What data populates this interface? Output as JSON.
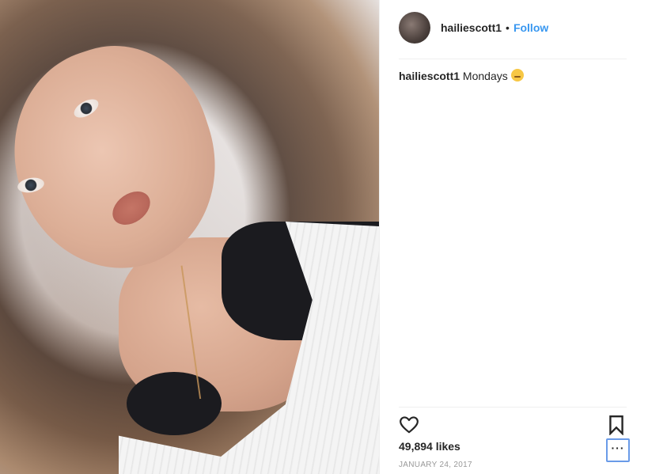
{
  "post": {
    "username": "hailiescott1",
    "follow_label": "Follow",
    "separator": "•",
    "caption_username": "hailiescott1",
    "caption_text": "Mondays",
    "caption_emoji": "sleeping-face-emoji",
    "likes": "49,894 likes",
    "date": "JANUARY 24, 2017",
    "more_label": "···"
  },
  "colors": {
    "link": "#3897f0",
    "text": "#262626",
    "muted": "#999999",
    "focus_outline": "#6a9be8"
  },
  "icons": {
    "like": "heart-outline-icon",
    "save": "bookmark-outline-icon",
    "more": "more-options-icon"
  }
}
